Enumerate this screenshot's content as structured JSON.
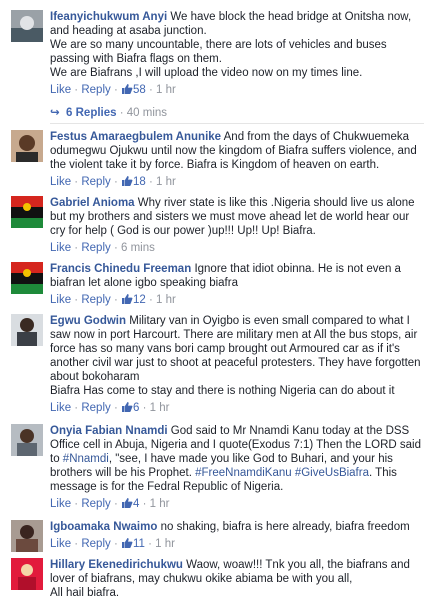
{
  "actions": {
    "like": "Like",
    "reply": "Reply",
    "dot": " · "
  },
  "comments": [
    {
      "author": "Ifeanyichukwum Anyi",
      "lines": [
        "We have block the head bridge at Onitsha now, and heading at asaba junction.",
        "We are so many uncountable, there are lots of vehicles and buses passing with Biafra flags on them.",
        "We are Biafrans ,I will upload the video now on my times line."
      ],
      "likes": "58",
      "time": "1 hr",
      "replies": "6 Replies",
      "replies_time": "40 mins"
    },
    {
      "author": "Festus Amaraegbulem Anunike",
      "lines": [
        "And from the days of Chukwuemeka odumegwu Ojukwu until now the kingdom of Biafra suffers violence, and the violent take it by force. Biafra is Kingdom of heaven on earth."
      ],
      "likes": "18",
      "time": "1 hr"
    },
    {
      "author": "Gabriel Anioma",
      "lines": [
        "Why river state is like this .Nigeria should live us alone but my brothers and sisters we must move ahead let de world hear our cry for help ( God is our power )up!!! Up!! Up! Biafra."
      ],
      "time": "6 mins"
    },
    {
      "author": "Francis Chinedu Freeman",
      "lines": [
        "Ignore that idiot obinna. He is not even a biafran let alone igbo speaking biafra"
      ],
      "likes": "12",
      "time": "1 hr"
    },
    {
      "author": "Egwu Godwin",
      "lines": [
        "Military van in Oyigbo is even small compared to what I saw now in port Harcourt. There are military men at All the bus stops, air force has so many vans bori camp brought out Armoured car as if it's another civil war just to shoot at peaceful protesters. They have forgotten about bokoharam",
        "Biafra Has come to stay and there is nothing Nigeria can do about it"
      ],
      "likes": "6",
      "time": "1 hr"
    },
    {
      "author": "Onyia Fabian Nnamdi",
      "text_a": "God said to Mr Nnamdi Kanu today at the DSS Office cell in Abuja, Nigeria and I quote(Exodus 7:1) Then the LORD said to ",
      "tag1": "#Nnamdi",
      "text_b": ", \"see, I have made you like God to Buhari, and your his brothers will be his Prophet. ",
      "tag2": "#FreeNnamdiKanu",
      "tag3": "#GiveUsBiafra",
      "text_c": ". This message is for the Fedral Republic of Nigeria.",
      "likes": "4",
      "time": "1 hr"
    },
    {
      "author": "Igboamaka Nwaimo",
      "lines": [
        "no shaking, biafra is here already, biafra freedom"
      ],
      "likes": "11",
      "time": "1 hr"
    },
    {
      "author": "Hillary Ekenedirichukwu",
      "lines": [
        "Waow, woaw!!! Tnk you all, the biafrans and lover of biafrans, may chukwu okike abiama be with you all,",
        "All hail biafra."
      ]
    }
  ],
  "colors": {
    "link": "#365899",
    "meta": "#90949c",
    "action": "#4267b2"
  }
}
